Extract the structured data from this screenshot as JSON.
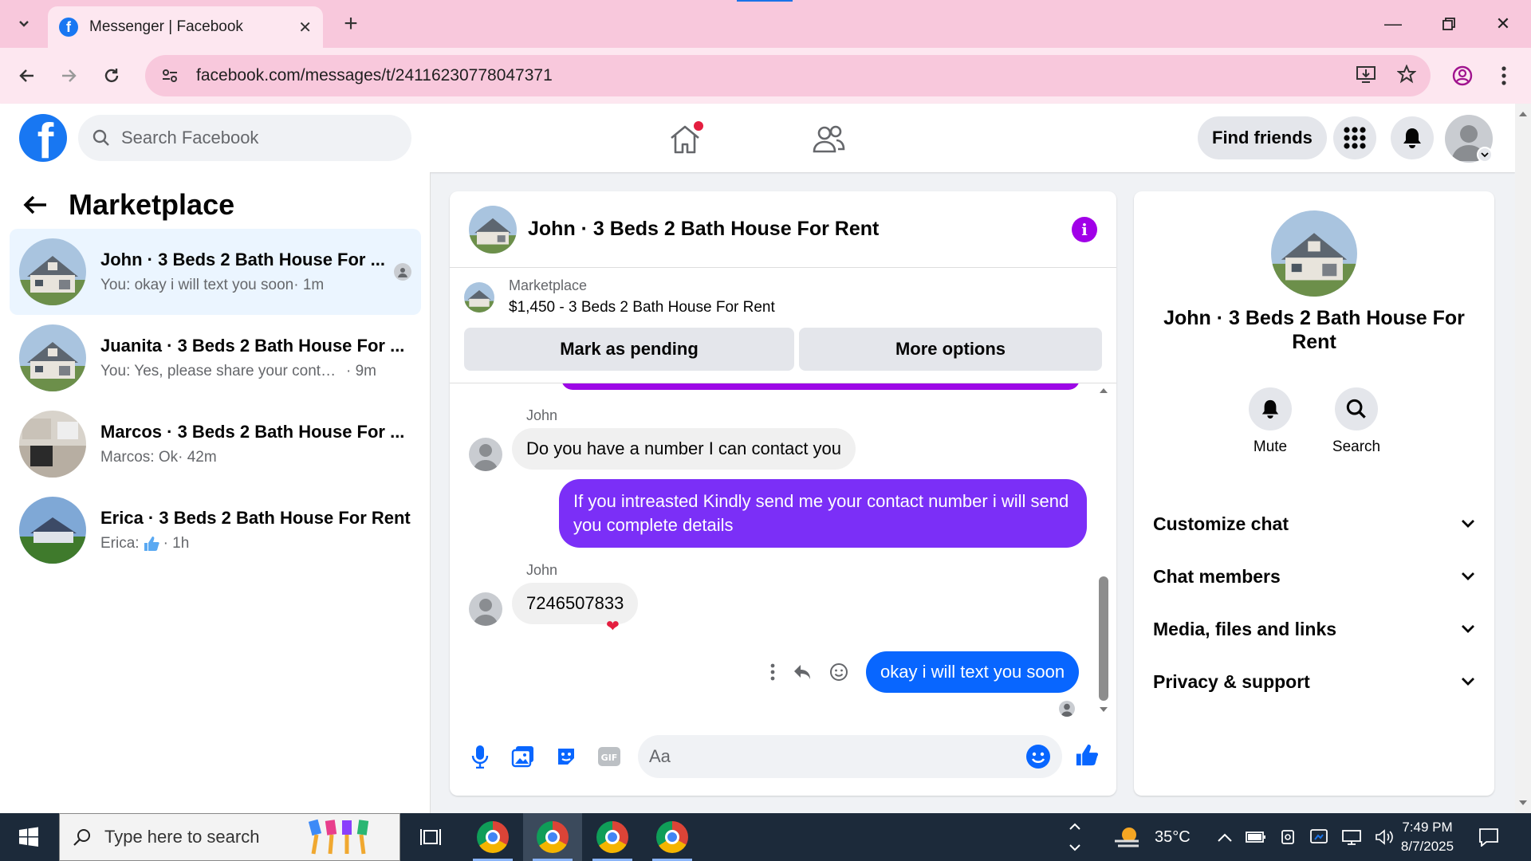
{
  "browser": {
    "tab_title": "Messenger | Facebook",
    "url": "facebook.com/messages/t/24116230778047371"
  },
  "fb": {
    "search_placeholder": "Search Facebook",
    "find_friends": "Find friends"
  },
  "left": {
    "title": "Marketplace",
    "conversations": [
      {
        "name": "John · 3 Beds 2 Bath House For ...",
        "preview": "You: okay i will text you soon",
        "time": "· 1m"
      },
      {
        "name": "Juanita · 3 Beds 2 Bath House For ...",
        "preview": "You: Yes, please share your contact n...",
        "time": "· 9m"
      },
      {
        "name": "Marcos · 3 Beds 2 Bath House For ...",
        "preview": "Marcos: Ok",
        "time": "· 42m"
      },
      {
        "name": "Erica · 3 Beds 2 Bath House For Rent",
        "preview": "Erica:",
        "time": "· 1h"
      }
    ]
  },
  "chat": {
    "title": "John · 3 Beds 2 Bath House For Rent",
    "listing_label": "Marketplace",
    "listing_price": "$1,450 - 3 Beds 2 Bath House For Rent",
    "mark_pending": "Mark as pending",
    "more_options": "More options",
    "messages": [
      {
        "sender": "John",
        "text": "Do you have a number I can contact you"
      },
      {
        "text": "If you intreasted Kindly send me your contact number i will send you complete details"
      },
      {
        "sender": "John",
        "text": "7246507833",
        "reaction": "❤"
      },
      {
        "text": "okay i will text you soon"
      }
    ],
    "composer_placeholder": "Aa",
    "colors": {
      "outgoing": "#7b2ff7",
      "outgoing_last": "#0866ff"
    }
  },
  "right": {
    "name": "John · 3 Beds 2 Bath House For Rent",
    "mute": "Mute",
    "search": "Search",
    "sections": [
      "Customize chat",
      "Chat members",
      "Media, files and links",
      "Privacy & support"
    ]
  },
  "taskbar": {
    "search_placeholder": "Type here to search",
    "temperature": "35°C",
    "time": "7:49 PM",
    "date": "8/7/2025"
  }
}
